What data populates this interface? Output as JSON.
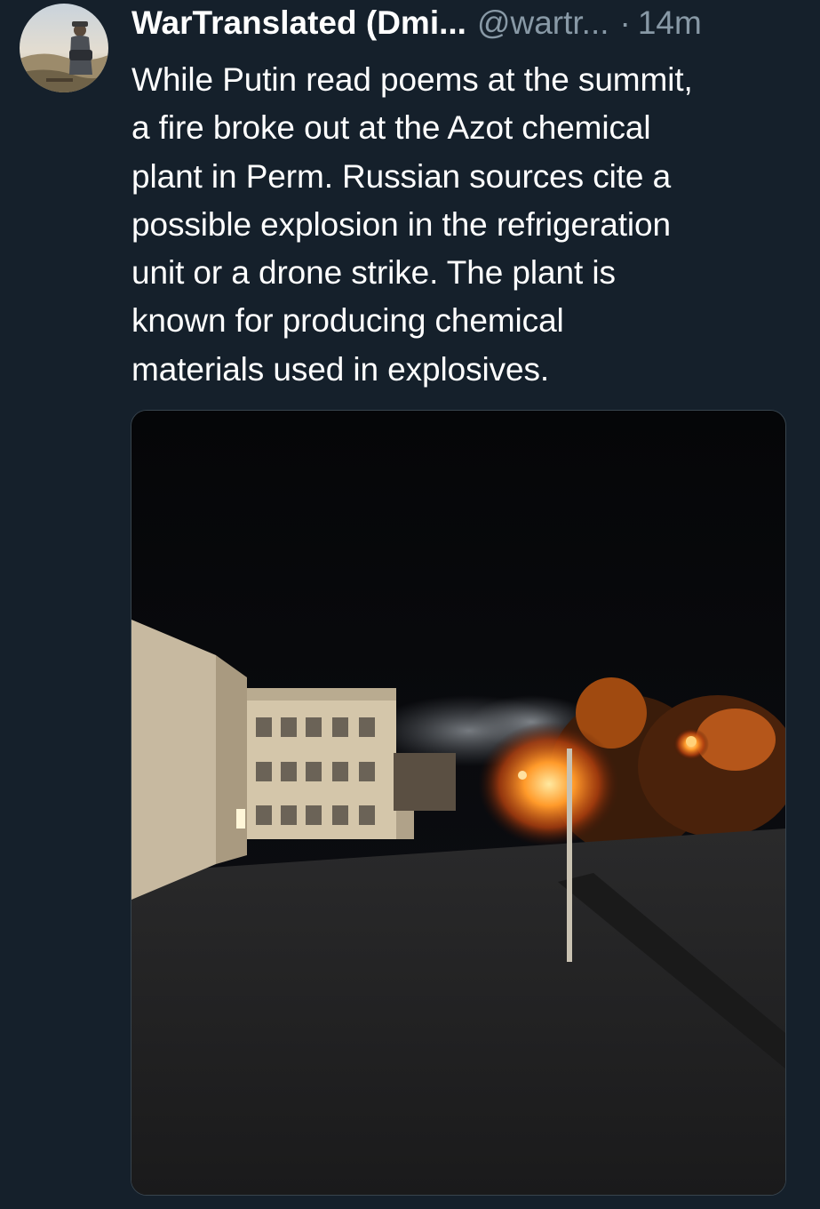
{
  "tweet": {
    "display_name": "WarTranslated (Dmi...",
    "handle": "@wartr...",
    "separator": "·",
    "timestamp": "14m",
    "text_lines": [
      "While Putin read poems at the summit,",
      "a fire broke out at the Azot chemical",
      "plant in Perm. Russian sources cite a",
      "possible explosion in the refrigeration",
      "unit or a drone strike. The plant is",
      "known for producing chemical",
      "materials used in explosives."
    ]
  },
  "colors": {
    "background": "#15202b",
    "text_primary": "#ffffff",
    "text_secondary": "#8899a6",
    "media_border": "#38444d"
  }
}
